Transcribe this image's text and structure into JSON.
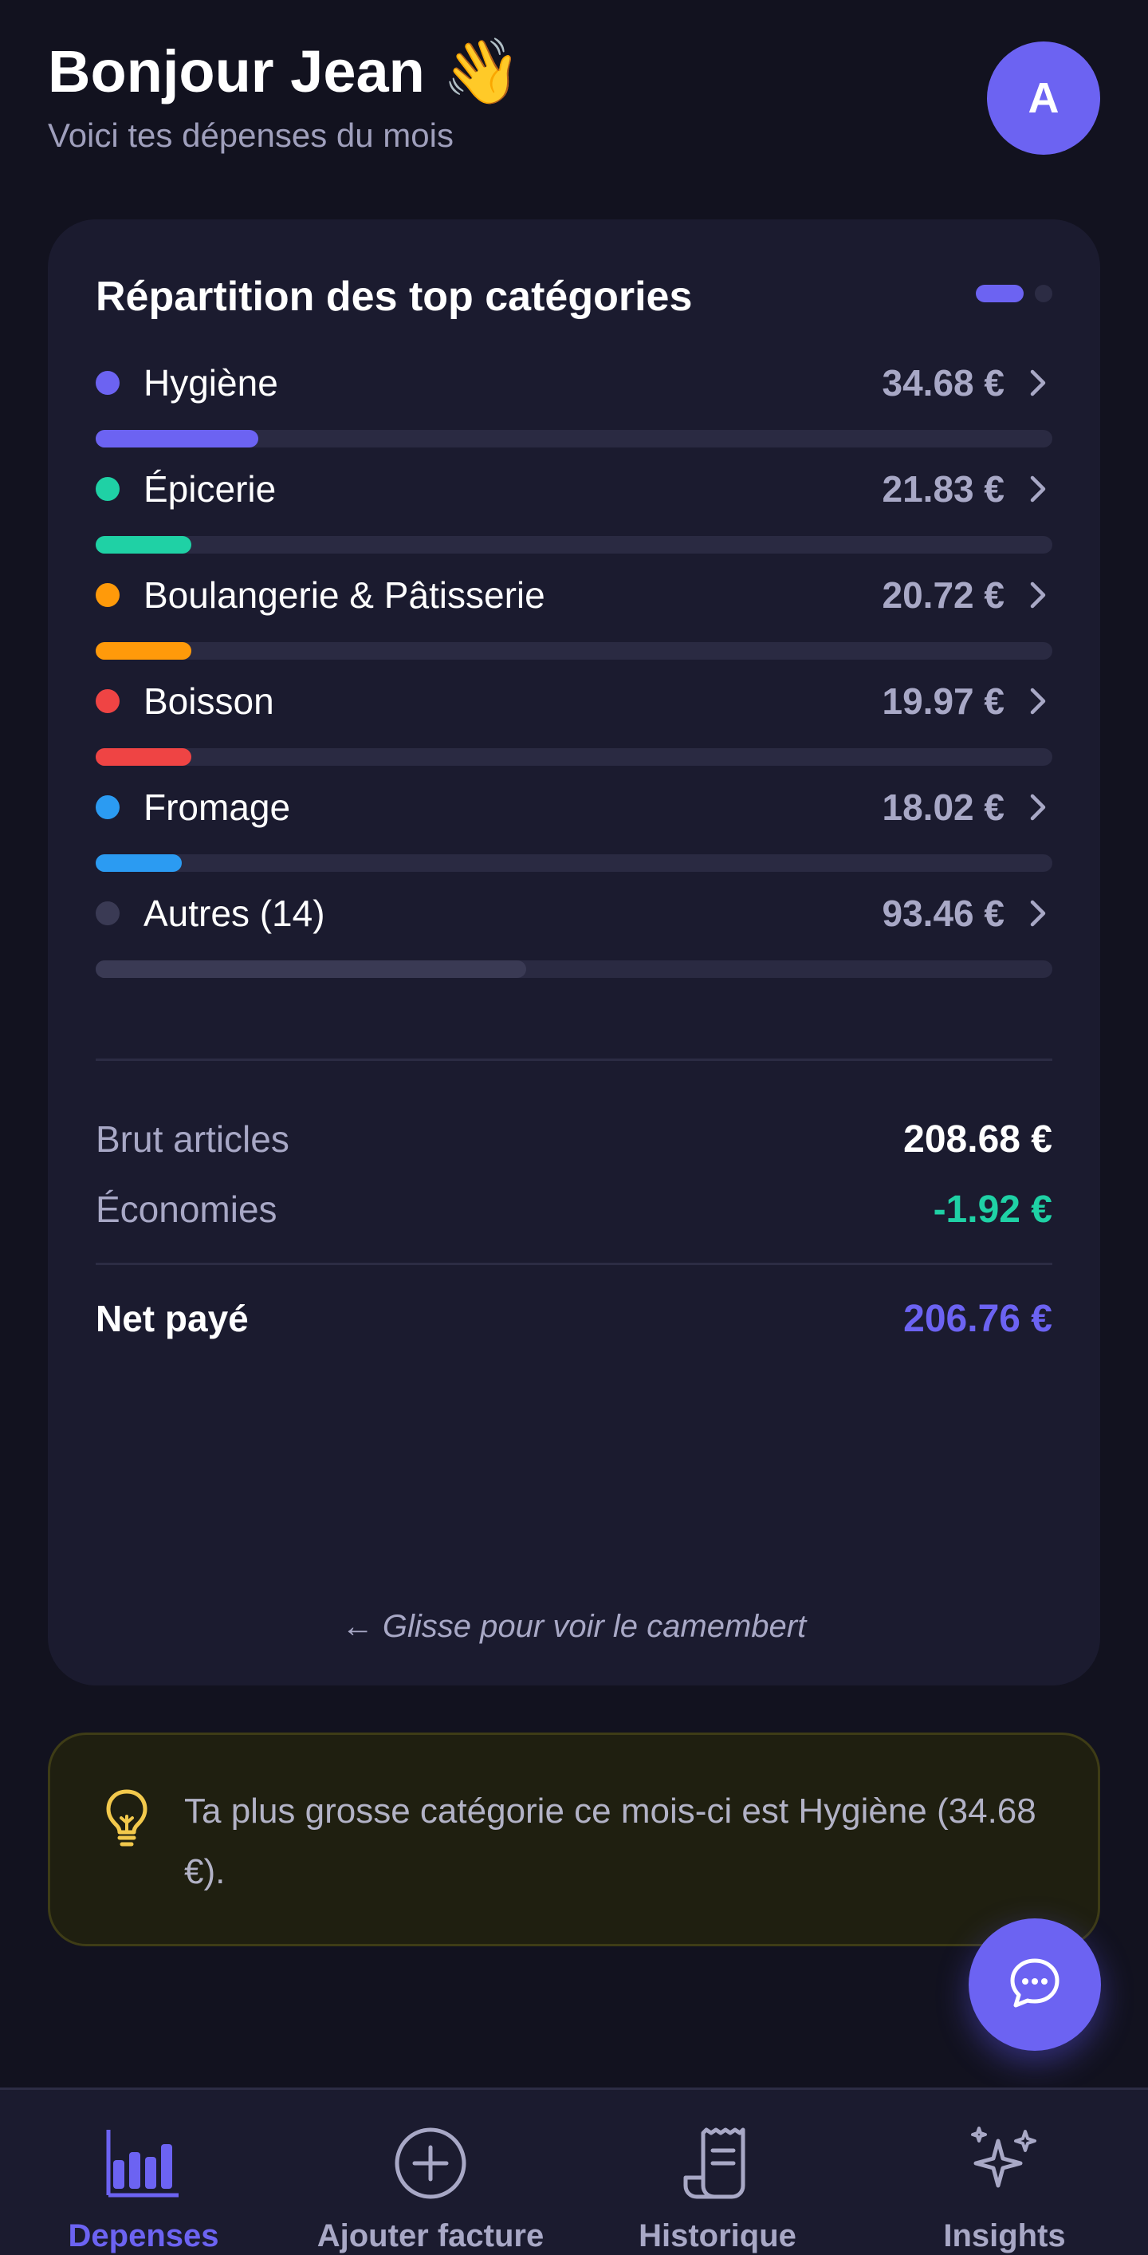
{
  "header": {
    "greeting": "Bonjour Jean",
    "wave_emoji": "👋",
    "subtitle": "Voici tes dépenses du mois",
    "avatar_initial": "A"
  },
  "card": {
    "title": "Répartition des top catégories",
    "categories": [
      {
        "name": "Hygiène",
        "amount": "34.68 €",
        "color": "#6c63f2",
        "share": 0.17
      },
      {
        "name": "Épicerie",
        "amount": "21.83 €",
        "color": "#1fd1a5",
        "share": 0.1
      },
      {
        "name": "Boulangerie & Pâtisserie",
        "amount": "20.72 €",
        "color": "#ff9a0a",
        "share": 0.1
      },
      {
        "name": "Boisson",
        "amount": "19.97 €",
        "color": "#ef4444",
        "share": 0.1
      },
      {
        "name": "Fromage",
        "amount": "18.02 €",
        "color": "#2b9bf2",
        "share": 0.09
      },
      {
        "name": "Autres (14)",
        "amount": "93.46 €",
        "color": "#3a3a54",
        "share": 0.45
      }
    ],
    "totals": {
      "gross_label": "Brut articles",
      "gross_value": "208.68 €",
      "savings_label": "Économies",
      "savings_value": "-1.92 €",
      "net_label": "Net payé",
      "net_value": "206.76 €"
    },
    "swipe_hint": "← Glisse pour voir le camembert"
  },
  "tip": {
    "text": "Ta plus grosse catégorie ce mois-ci est Hygiène (34.68 €).",
    "icon": "lightbulb-icon"
  },
  "fab": {
    "icon": "chat-bubble-icon"
  },
  "nav": {
    "items": [
      {
        "label": "Depenses",
        "icon": "bar-chart-icon",
        "active": true
      },
      {
        "label": "Ajouter facture",
        "icon": "plus-circle-icon",
        "active": false
      },
      {
        "label": "Historique",
        "icon": "receipt-icon",
        "active": false
      },
      {
        "label": "Insights",
        "icon": "sparkles-icon",
        "active": false
      }
    ]
  },
  "colors": {
    "accent": "#6c63f2",
    "background": "#12121f",
    "card": "#1b1b2f",
    "savings": "#1fd1a5",
    "tip_icon": "#f2c94c"
  }
}
